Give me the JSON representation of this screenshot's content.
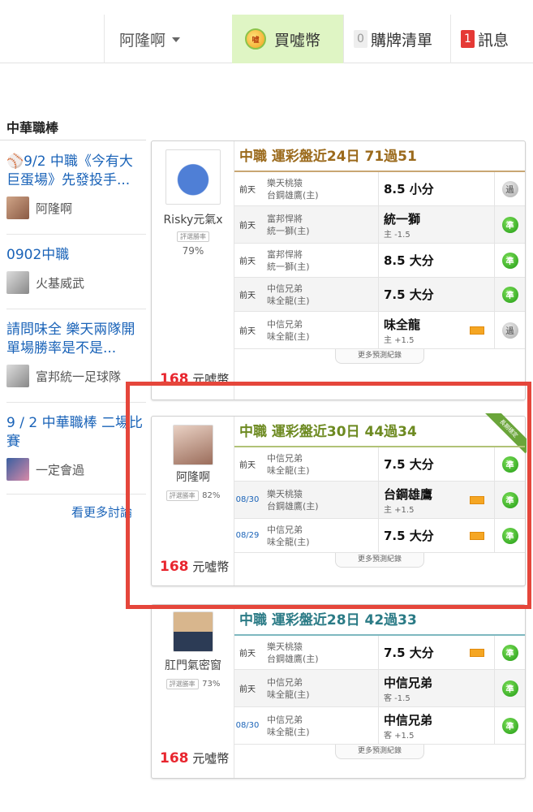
{
  "nav": {
    "user": "阿隆啊",
    "buy_label": "買噓幣",
    "coin_text": "嘘",
    "list_count": "0",
    "list_label": "購牌清單",
    "msg_count": "1",
    "msg_label": "訊息"
  },
  "sidebar": {
    "title": "中華職棒",
    "topics": [
      {
        "title": "⚾9/2 中職《今有大巨蛋場》先發投手...",
        "user": "阿隆啊"
      },
      {
        "title": "0902中職",
        "user": "火基威武"
      },
      {
        "title": "請問味全 樂天兩隊開單場勝率是不是...",
        "user": "富邦統一足球隊"
      },
      {
        "title": "9 / 2 中華職棒 二場比賽",
        "user": "一定會過"
      }
    ],
    "more": "看更多討論"
  },
  "cards": [
    {
      "name": "Risky元氣x",
      "rate_label": "評選勝率",
      "rate": "79%",
      "price": "168",
      "price_unit": "元噓幣",
      "header": "中職 運彩盤近24日 71過51",
      "rows": [
        {
          "when": "前天",
          "team1": "樂天桃猿",
          "team2": "台鋼雄鷹(主)",
          "pick": "8.5 小分",
          "sub": "",
          "result": "過"
        },
        {
          "when": "前天",
          "team1": "富邦悍將",
          "team2": "統一獅(主)",
          "pick": "統一獅",
          "sub": "主 -1.5",
          "result": "準"
        },
        {
          "when": "前天",
          "team1": "富邦悍將",
          "team2": "統一獅(主)",
          "pick": "8.5 大分",
          "sub": "",
          "result": "準"
        },
        {
          "when": "前天",
          "team1": "中信兄弟",
          "team2": "味全龍(主)",
          "pick": "7.5 大分",
          "sub": "",
          "result": "準"
        },
        {
          "when": "前天",
          "team1": "中信兄弟",
          "team2": "味全龍(主)",
          "pick": "味全龍",
          "sub": "主 +1.5",
          "result": "過"
        }
      ],
      "more": "更多預測紀錄"
    },
    {
      "name": "阿隆啊",
      "rate_label": "評選勝率",
      "rate": "82%",
      "price": "168",
      "price_unit": "元噓幣",
      "header": "中職 運彩盤近30日 44過34",
      "ribbon": "長期穩定",
      "rows": [
        {
          "when": "前天",
          "team1": "中信兄弟",
          "team2": "味全龍(主)",
          "pick": "7.5 大分",
          "sub": "",
          "result": "準"
        },
        {
          "when": "08/30",
          "team1": "樂天桃猿",
          "team2": "台鋼雄鷹(主)",
          "pick": "台鋼雄鷹",
          "sub": "主 +1.5",
          "result": "準"
        },
        {
          "when": "08/29",
          "team1": "中信兄弟",
          "team2": "味全龍(主)",
          "pick": "7.5 大分",
          "sub": "",
          "result": "準"
        }
      ],
      "more": "更多預測紀錄"
    },
    {
      "name": "肛門氣密窗",
      "rate_label": "評選勝率",
      "rate": "73%",
      "price": "168",
      "price_unit": "元噓幣",
      "header": "中職 運彩盤近28日 42過33",
      "rows": [
        {
          "when": "前天",
          "team1": "樂天桃猿",
          "team2": "台鋼雄鷹(主)",
          "pick": "7.5 大分",
          "sub": "",
          "result": "準"
        },
        {
          "when": "前天",
          "team1": "中信兄弟",
          "team2": "味全龍(主)",
          "pick": "中信兄弟",
          "sub": "客 -1.5",
          "result": "準"
        },
        {
          "when": "08/30",
          "team1": "中信兄弟",
          "team2": "味全龍(主)",
          "pick": "中信兄弟",
          "sub": "客 +1.5",
          "result": "準"
        }
      ],
      "more": "更多預測紀錄"
    }
  ]
}
